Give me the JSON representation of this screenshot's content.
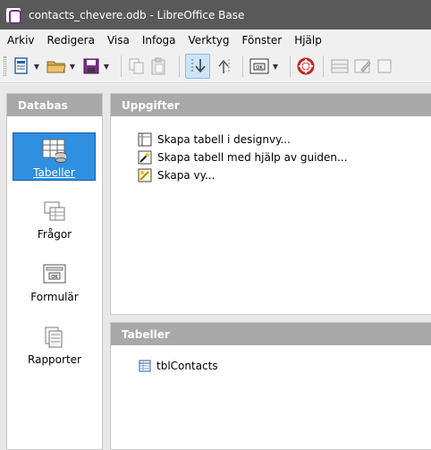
{
  "window": {
    "title": "contacts_chevere.odb - LibreOffice Base"
  },
  "menubar": {
    "items": [
      "Arkiv",
      "Redigera",
      "Visa",
      "Infoga",
      "Verktyg",
      "Fönster",
      "Hjälp"
    ]
  },
  "toolbar": {
    "icons": [
      "new-document-icon",
      "open-folder-icon",
      "save-icon",
      "copy-icon",
      "paste-icon",
      "sort-descending-icon",
      "sort-ascending-icon",
      "form-view-icon",
      "help-lifebuoy-icon",
      "table-icon",
      "edit-icon",
      "delete-icon"
    ]
  },
  "left_panel": {
    "header": "Databas",
    "items": [
      {
        "label": "Tabeller",
        "icon": "table-icon",
        "selected": true
      },
      {
        "label": "Frågor",
        "icon": "queries-icon",
        "selected": false
      },
      {
        "label": "Formulär",
        "icon": "forms-icon",
        "selected": false
      },
      {
        "label": "Rapporter",
        "icon": "reports-icon",
        "selected": false
      }
    ]
  },
  "tasks_panel": {
    "header": "Uppgifter",
    "items": [
      {
        "label": "Skapa tabell i designvy...",
        "icon": "design-view-icon"
      },
      {
        "label": "Skapa tabell med hjälp av guiden...",
        "icon": "wizard-icon"
      },
      {
        "label": "Skapa vy...",
        "icon": "create-view-icon"
      }
    ]
  },
  "tables_panel": {
    "header": "Tabeller",
    "items": [
      {
        "label": "tblContacts",
        "icon": "table-small-icon"
      }
    ]
  },
  "colors": {
    "titlebar": "#595959",
    "selected": "#2f8fe0",
    "panel_header": "#a9a9a9"
  }
}
